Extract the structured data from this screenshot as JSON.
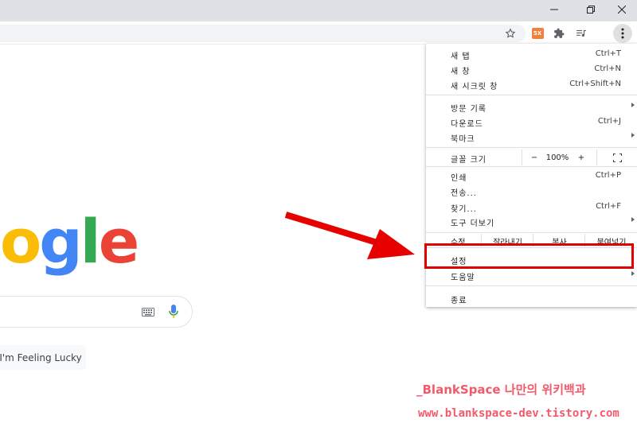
{
  "window_controls": {
    "minimize": "–",
    "restore": "❐",
    "close": "✕"
  },
  "toolbar": {
    "extension_badge": "5X",
    "icons": [
      "star-icon",
      "extension-badge-icon",
      "puzzle-icon",
      "playlist-icon",
      "kebab-menu-icon"
    ]
  },
  "page": {
    "logo_letters": [
      {
        "ch": "o",
        "color": "#fbbc05"
      },
      {
        "ch": "g",
        "color": "#4285f4"
      },
      {
        "ch": "l",
        "color": "#34a853"
      },
      {
        "ch": "e",
        "color": "#ea4335"
      }
    ],
    "lucky_label": "I'm Feeling Lucky"
  },
  "menu": {
    "new_tab": {
      "label": "새 탭",
      "shortcut": "Ctrl+T"
    },
    "new_window": {
      "label": "새 창",
      "shortcut": "Ctrl+N"
    },
    "incognito": {
      "label": "새 시크릿 창",
      "shortcut": "Ctrl+Shift+N"
    },
    "history": {
      "label": "방문 기록"
    },
    "downloads": {
      "label": "다운로드",
      "shortcut": "Ctrl+J"
    },
    "bookmarks": {
      "label": "북마크"
    },
    "zoom": {
      "label": "글꼴 크기",
      "minus": "−",
      "value": "100%",
      "plus": "+"
    },
    "print": {
      "label": "인쇄",
      "shortcut": "Ctrl+P"
    },
    "cast": {
      "label": "전송..."
    },
    "find": {
      "label": "찾기...",
      "shortcut": "Ctrl+F"
    },
    "more_tools": {
      "label": "도구 더보기"
    },
    "edit": {
      "label": "수정",
      "cut": "잘라내기",
      "copy": "복사",
      "paste": "붙여넣기"
    },
    "settings": {
      "label": "설정"
    },
    "help": {
      "label": "도움말"
    },
    "exit": {
      "label": "종료"
    }
  },
  "watermark": {
    "line1": "_BlankSpace 나만의 위키백과",
    "line2": "www.blankspace-dev.tistory.com"
  },
  "colors": {
    "highlight": "#e00000",
    "arrow": "#e60000",
    "watermark": "#f25a6c"
  }
}
